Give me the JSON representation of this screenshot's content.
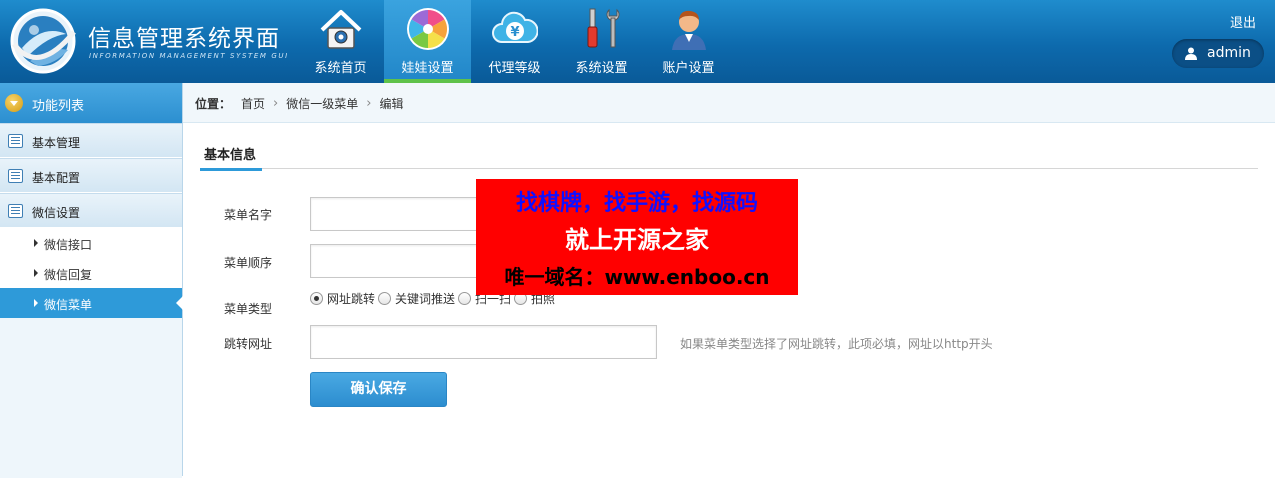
{
  "header": {
    "title": "信息管理系统界面",
    "subtitle": "INFORMATION MANAGEMENT SYSTEM GUI",
    "logout": "退出",
    "username": "admin",
    "nav": [
      {
        "label": "系统首页",
        "icon": "home-icon"
      },
      {
        "label": "娃娃设置",
        "icon": "color-wheel-icon",
        "active": true
      },
      {
        "label": "代理等级",
        "icon": "yen-cloud-icon"
      },
      {
        "label": "系统设置",
        "icon": "tools-icon"
      },
      {
        "label": "账户设置",
        "icon": "user-account-icon"
      }
    ]
  },
  "sidebar": {
    "header": "功能列表",
    "groups": [
      {
        "label": "基本管理"
      },
      {
        "label": "基本配置"
      },
      {
        "label": "微信设置",
        "items": [
          {
            "label": "微信接口"
          },
          {
            "label": "微信回复"
          },
          {
            "label": "微信菜单",
            "active": true
          }
        ]
      }
    ]
  },
  "breadcrumb": {
    "label": "位置：",
    "items": [
      "首页",
      "微信一级菜单",
      "编辑"
    ]
  },
  "form": {
    "tab": "基本信息",
    "fields": {
      "name": {
        "label": "菜单名字",
        "value": ""
      },
      "order": {
        "label": "菜单顺序",
        "value": ""
      },
      "type": {
        "label": "菜单类型",
        "options": [
          "网址跳转",
          "关键词推送",
          "扫一扫",
          "拍照"
        ],
        "selected": "网址跳转"
      },
      "url": {
        "label": "跳转网址",
        "value": "",
        "hint": "如果菜单类型选择了网址跳转，此项必填，网址以http开头"
      }
    },
    "submit": "确认保存"
  },
  "ad": {
    "line1": "找棋牌，找手游，找源码",
    "line2": "就上开源之家",
    "line3": "唯一域名：www.enboo.cn"
  },
  "colors": {
    "header_bg": "#0d6aad",
    "active_nav": "#2186c8",
    "active_underline": "#5fc24a",
    "sidebar_active": "#2e9ad9",
    "button": "#2c8dcf",
    "ad_bg": "#ff0000"
  }
}
